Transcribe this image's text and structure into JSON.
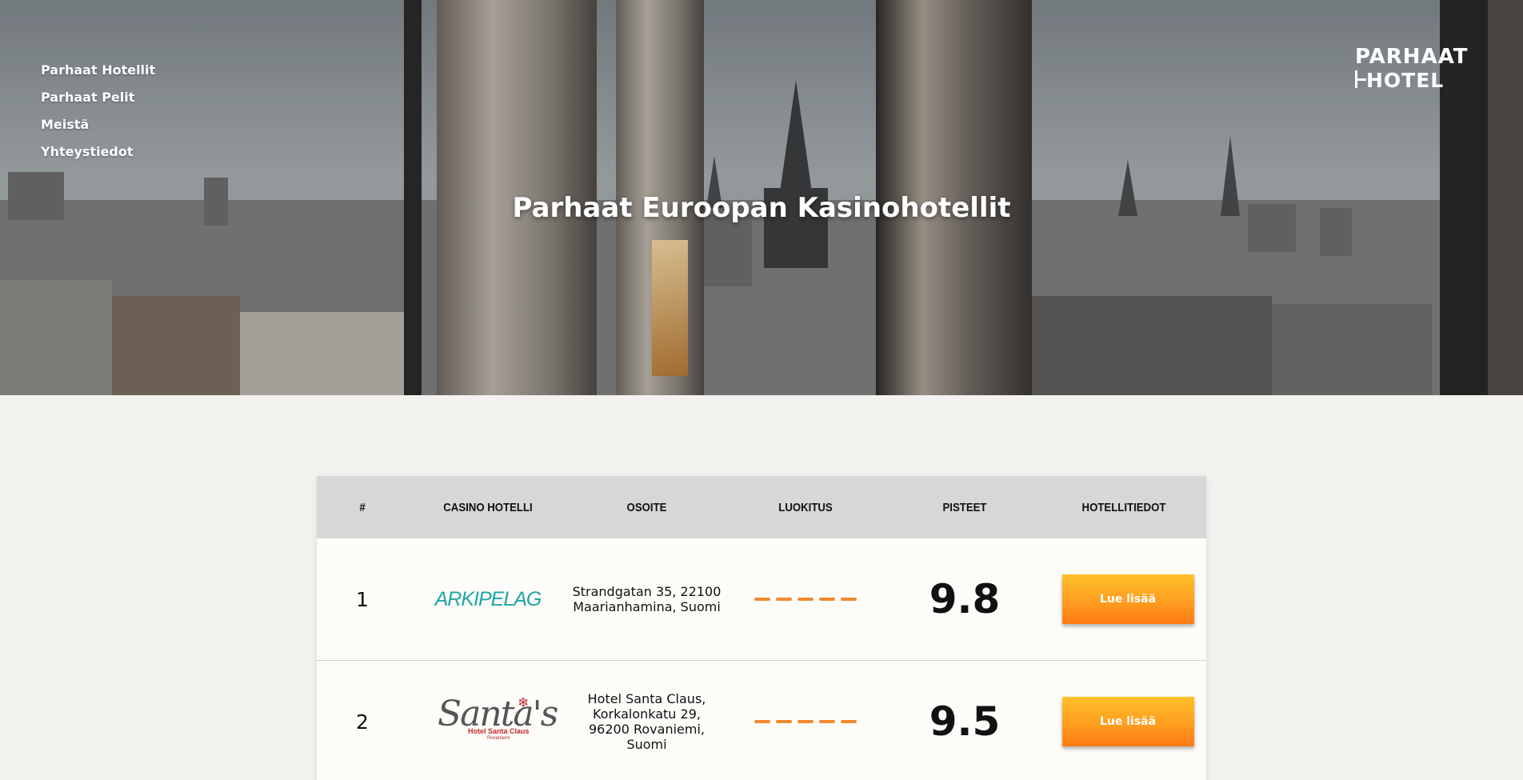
{
  "nav": {
    "items": [
      {
        "label": "Parhaat Hotellit"
      },
      {
        "label": "Parhaat Pelit"
      },
      {
        "label": "Meistä"
      },
      {
        "label": "Yhteystiedot"
      }
    ]
  },
  "logo": {
    "line1": "PARHAAT",
    "line2": "HOTEL"
  },
  "hero": {
    "title": "Parhaat Euroopan Kasinohotellit"
  },
  "table": {
    "headers": [
      "#",
      "CASINO HOTELLI",
      "OSOITE",
      "LUOKITUS",
      "PISTEET",
      "HOTELLITIEDOT"
    ],
    "rows": [
      {
        "rank": "1",
        "hotel_logo_text": "ARKIPELAG",
        "address": "Strandgatan 35, 22100 Maarianhamina, Suomi",
        "score": "9.8",
        "button": "Lue lisää"
      },
      {
        "rank": "2",
        "hotel_logo_text": "Santa's",
        "hotel_logo_sub": "Hotel Santa Claus",
        "hotel_logo_sub2": "Rovaniemi",
        "address": "Hotel Santa Claus, Korkalonkatu 29, 96200 Rovaniemi, Suomi",
        "score": "9.5",
        "button": "Lue lisää"
      }
    ]
  },
  "colors": {
    "accent": "#f28a2e",
    "button_top": "#ffc12a",
    "button_bottom": "#ff7a14",
    "arkipelag_teal": "#1fa6a4",
    "santa_red": "#c0282d",
    "page_bg": "#f3f2ef",
    "header_bg": "#d7d7d7"
  },
  "icons": [
    "bed-icon",
    "snowflake-icon"
  ]
}
